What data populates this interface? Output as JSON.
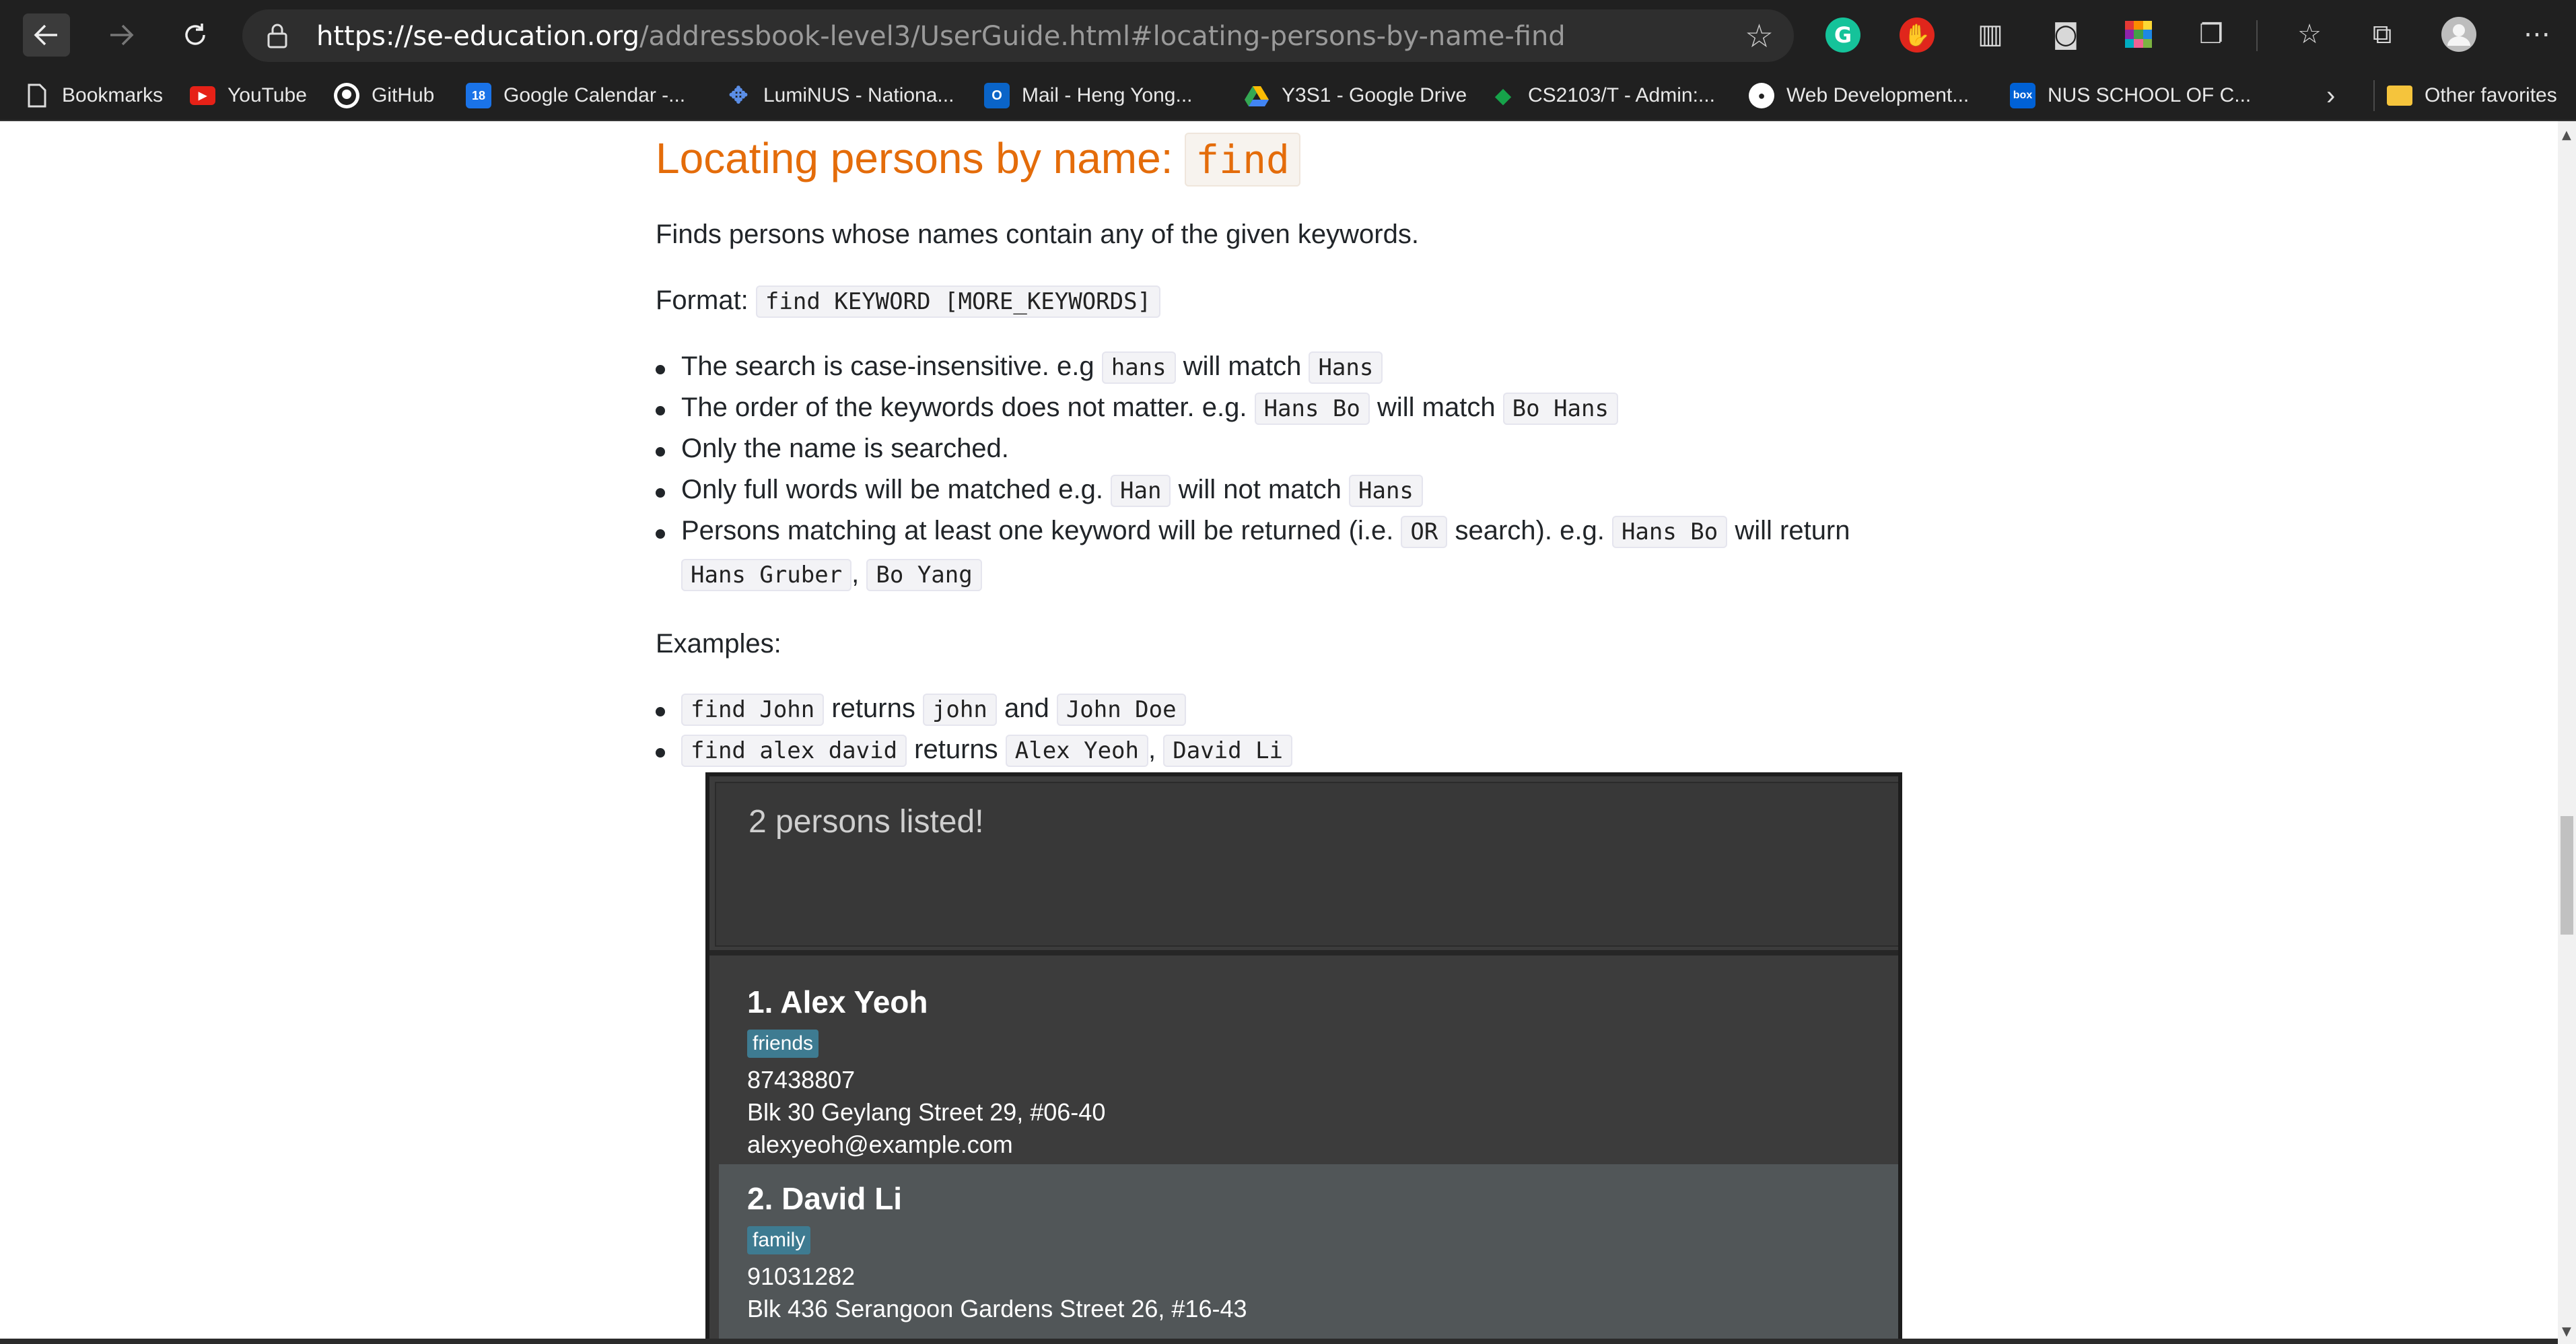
{
  "browser": {
    "url_host": "https://se-education.org",
    "url_path": "/addressbook-level3/UserGuide.html#locating-persons-by-name-find",
    "bookmarks": [
      {
        "label": "Bookmarks",
        "icon": "page-icon"
      },
      {
        "label": "YouTube",
        "icon": "youtube-icon"
      },
      {
        "label": "GitHub",
        "icon": "github-icon"
      },
      {
        "label": "Google Calendar -...",
        "icon": "calendar-icon",
        "icon_text": "18"
      },
      {
        "label": "LumiNUS - Nationa...",
        "icon": "luminus-icon"
      },
      {
        "label": "Mail - Heng Yong...",
        "icon": "outlook-icon"
      },
      {
        "label": "Y3S1 - Google Drive",
        "icon": "drive-icon"
      },
      {
        "label": "CS2103/T - Admin:...",
        "icon": "grad-cap-icon"
      },
      {
        "label": "Web Development...",
        "icon": "web-dev-icon"
      },
      {
        "label": "NUS SCHOOL OF C...",
        "icon": "box-icon",
        "icon_text": "box"
      },
      {
        "label": "Other favorites",
        "icon": "folder-icon"
      }
    ],
    "ext_grammarly": "G"
  },
  "doc": {
    "heading_text": "Locating persons by name: ",
    "heading_code": "find",
    "intro": "Finds persons whose names contain any of the given keywords.",
    "format_label": "Format: ",
    "format_code": "find KEYWORD [MORE_KEYWORDS]",
    "b1_a": "The search is case-insensitive. e.g ",
    "b1_c1": "hans",
    "b1_b": " will match ",
    "b1_c2": "Hans",
    "b2_a": "The order of the keywords does not matter. e.g. ",
    "b2_c1": "Hans Bo",
    "b2_b": " will match ",
    "b2_c2": "Bo Hans",
    "b3": "Only the name is searched.",
    "b4_a": "Only full words will be matched e.g. ",
    "b4_c1": "Han",
    "b4_b": " will not match ",
    "b4_c2": "Hans",
    "b5_a": "Persons matching at least one keyword will be returned (i.e. ",
    "b5_c1": "OR",
    "b5_b": " search). e.g. ",
    "b5_c2": "Hans Bo",
    "b5_c": " will return",
    "b5_c3": "Hans Gruber",
    "b5_comma": ",",
    "b5_c4": "Bo Yang",
    "examples_label": "Examples:",
    "e1_c1": "find John",
    "e1_a": " returns ",
    "e1_c2": "john",
    "e1_b": " and ",
    "e1_c3": "John Doe",
    "e2_c1": "find alex david",
    "e2_a": " returns ",
    "e2_c2": "Alex Yeoh",
    "e2_comma": ",",
    "e2_c3": "David Li"
  },
  "app": {
    "result_text": "2 persons listed!",
    "persons": [
      {
        "name": "1.  Alex Yeoh",
        "tag": "friends",
        "phone": "87438807",
        "address": "Blk 30 Geylang Street 29, #06-40",
        "email": "alexyeoh@example.com"
      },
      {
        "name": "2.  David Li",
        "tag": "family",
        "phone": "91031282",
        "address": "Blk 436 Serangoon Gardens Street 26, #16-43"
      }
    ],
    "card_colors": [
      "#3c3c3c",
      "#515658"
    ]
  }
}
